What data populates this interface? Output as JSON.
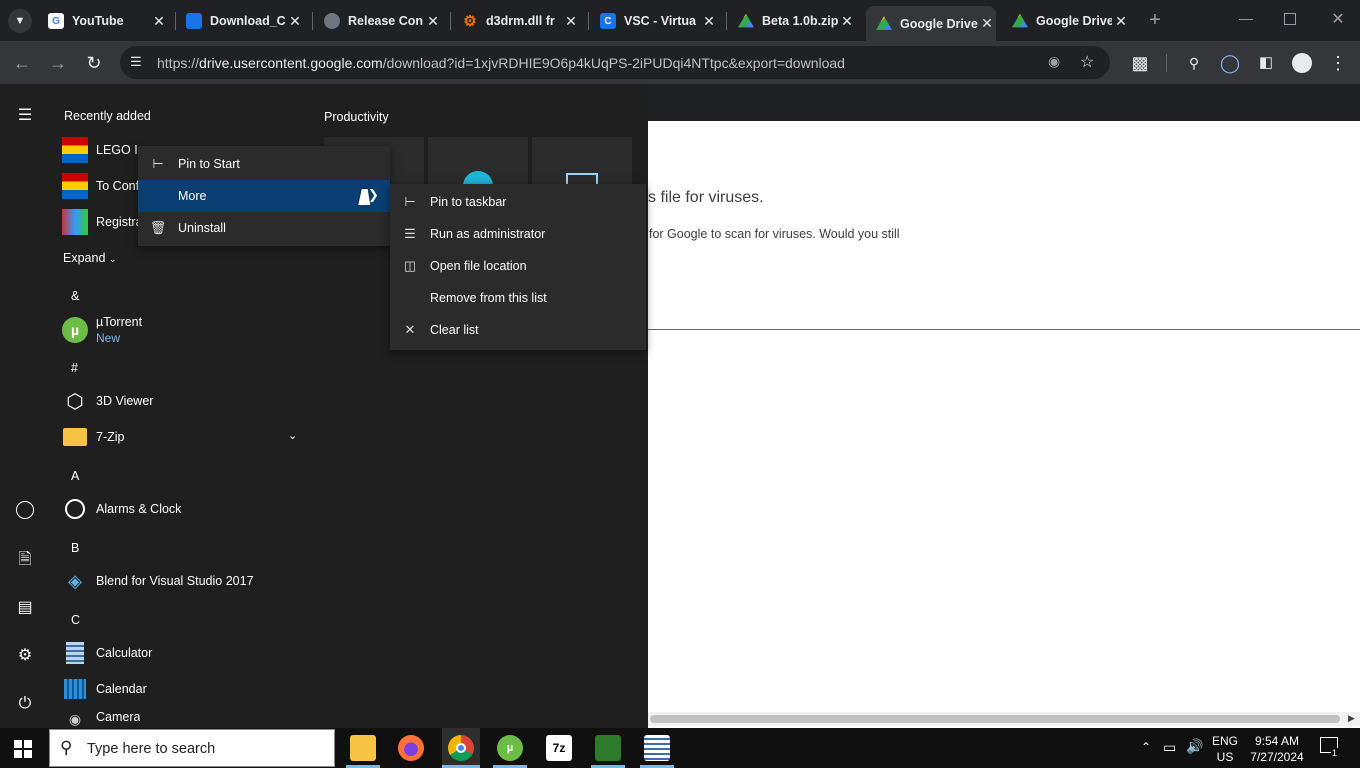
{
  "browser": {
    "tabs": [
      {
        "title": "YouTube",
        "icon": "google-icon",
        "color": "#4285f4"
      },
      {
        "title": "Download_C",
        "icon": "site-icon",
        "color": "#1a73e8"
      },
      {
        "title": "Release Con",
        "icon": "github-icon",
        "color": "#6e7681"
      },
      {
        "title": "d3drm.dll fr",
        "icon": "gear-icon",
        "color": "#e8710a"
      },
      {
        "title": "VSC - Virtua",
        "icon": "vsc-icon",
        "color": "#1a73e8"
      },
      {
        "title": "Beta 1.0b.zip",
        "icon": "drive-icon",
        "color": "#34a853"
      },
      {
        "title": "Google Drive",
        "icon": "drive-icon",
        "color": "#34a853"
      },
      {
        "title": "Google Drive",
        "icon": "drive-icon",
        "color": "#34a853"
      }
    ],
    "url_prefix": "https://",
    "url_domain": "drive.usercontent.google.com",
    "url_path": "/download?id=1xjvRDHIE9O6p4kUqPS-2iPUDqi4NTtpc&export=download"
  },
  "page": {
    "heading_fragment": "s file for viruses.",
    "body_fragment": "for Google to scan for viruses. Would you still"
  },
  "start_menu": {
    "recently_added_label": "Recently added",
    "productivity_label": "Productivity",
    "recent_apps": [
      "LEGO Is",
      "To Conf",
      "Registra"
    ],
    "expand_label": "Expand",
    "sections": [
      {
        "letter": "&",
        "apps": [
          {
            "name": "µTorrent",
            "badge": "New"
          }
        ]
      },
      {
        "letter": "#",
        "apps": [
          {
            "name": "3D Viewer"
          },
          {
            "name": "7-Zip"
          }
        ]
      },
      {
        "letter": "A",
        "apps": [
          {
            "name": "Alarms & Clock"
          }
        ]
      },
      {
        "letter": "B",
        "apps": [
          {
            "name": "Blend for Visual Studio 2017"
          }
        ]
      },
      {
        "letter": "C",
        "apps": [
          {
            "name": "Calculator"
          },
          {
            "name": "Calendar"
          },
          {
            "name": "Camera"
          }
        ]
      }
    ]
  },
  "context_menu": {
    "items": [
      "Pin to Start",
      "More",
      "Uninstall"
    ]
  },
  "submenu": {
    "items": [
      "Pin to taskbar",
      "Run as administrator",
      "Open file location",
      "Remove from this list",
      "Clear list"
    ]
  },
  "taskbar": {
    "search_placeholder": "Type here to search",
    "lang_top": "ENG",
    "lang_bottom": "US",
    "time": "9:54 AM",
    "date": "7/27/2024",
    "notification_count": "1",
    "seven_zip_label": "7z"
  },
  "colors": {
    "accent": "#0b3f74",
    "new_badge": "#76b9ed"
  }
}
